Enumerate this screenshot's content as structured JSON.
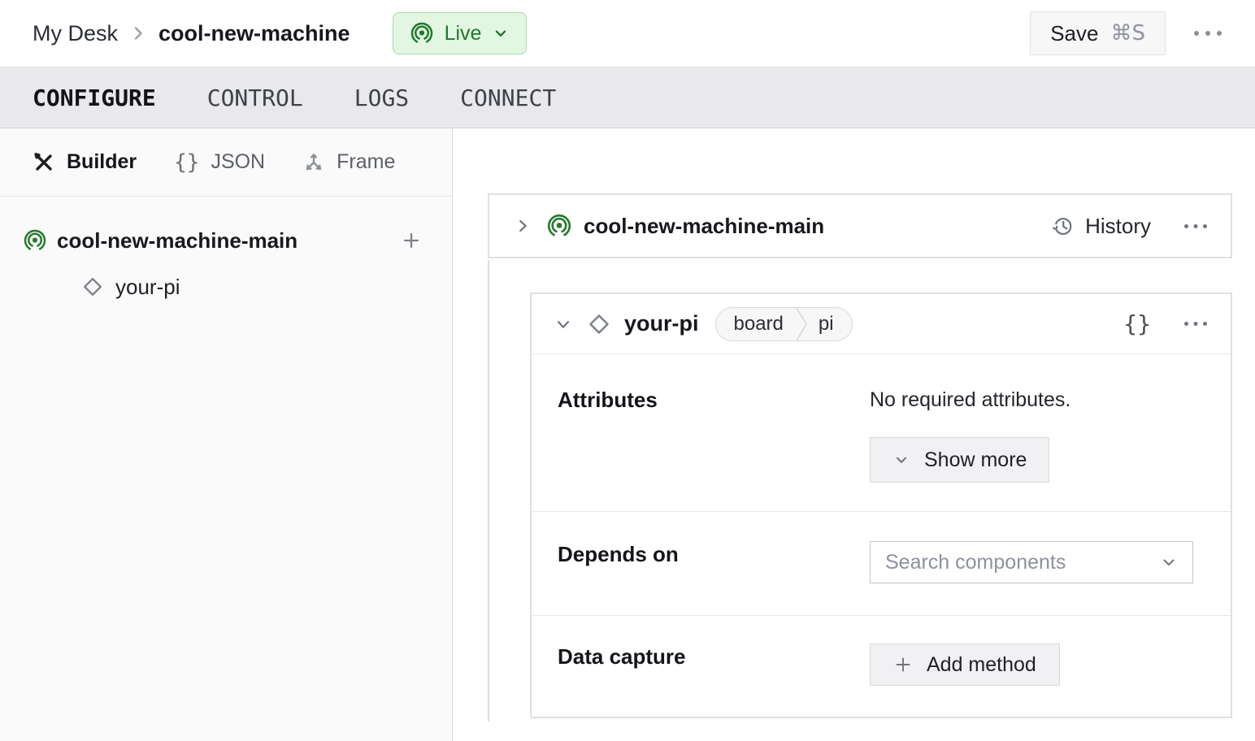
{
  "colors": {
    "accent_green": "#1f7a2d",
    "live_badge_bg": "#e3f6e2",
    "live_badge_border": "#a9dba9"
  },
  "topbar": {
    "breadcrumb": {
      "parent": "My Desk",
      "machine": "cool-new-machine"
    },
    "live_badge": "Live",
    "save_label": "Save",
    "save_shortcut": "⌘S"
  },
  "tabs": {
    "configure": "CONFIGURE",
    "control": "CONTROL",
    "logs": "LOGS",
    "connect": "CONNECT"
  },
  "sidebar": {
    "modes": {
      "builder": "Builder",
      "json": "JSON",
      "frame": "Frame"
    },
    "tree": {
      "part": "cool-new-machine-main",
      "component": "your-pi"
    }
  },
  "main": {
    "part_card": {
      "title": "cool-new-machine-main",
      "history": "History"
    },
    "component_card": {
      "title": "your-pi",
      "type_badge": "board",
      "model_badge": "pi",
      "attributes": {
        "label": "Attributes",
        "empty": "No required attributes.",
        "show_more": "Show more"
      },
      "depends_on": {
        "label": "Depends on",
        "placeholder": "Search components"
      },
      "data_capture": {
        "label": "Data capture",
        "add_method": "Add method"
      }
    }
  }
}
